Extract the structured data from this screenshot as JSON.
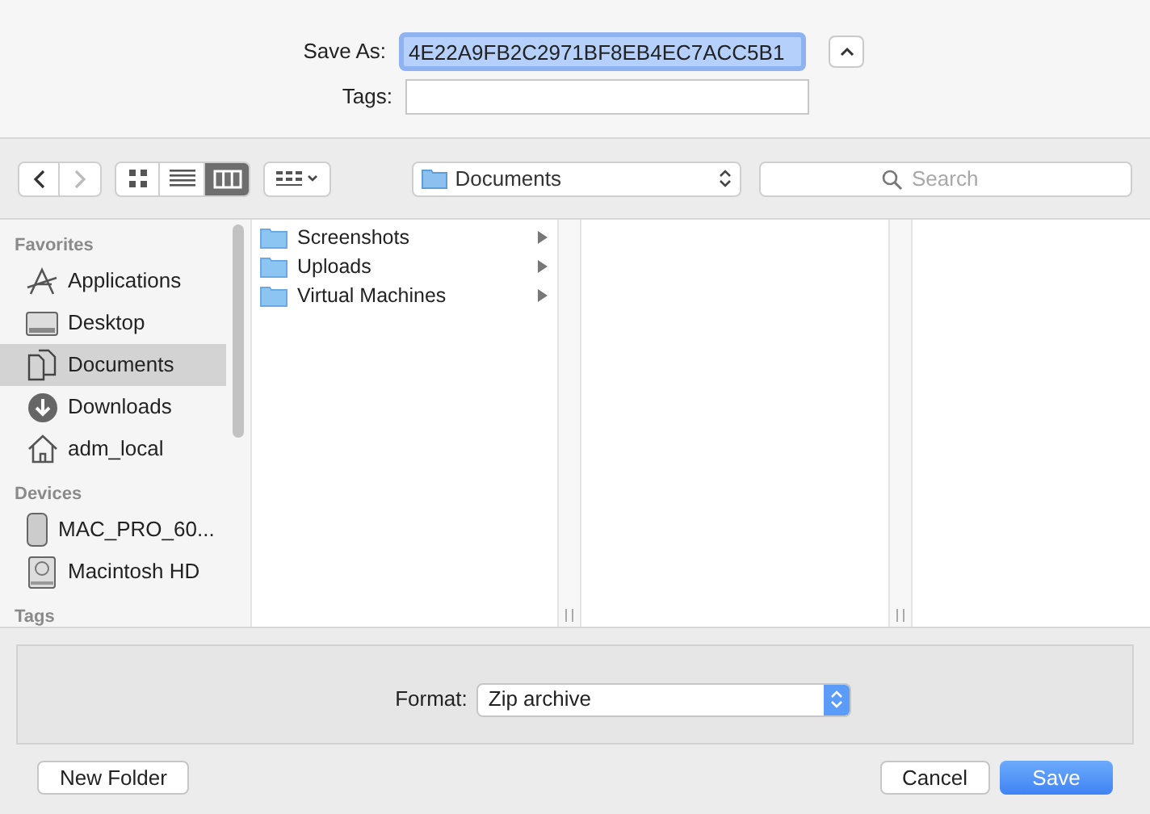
{
  "save_as": {
    "label": "Save As:",
    "value": "4E22A9FB2C2971BF8EB4EC7ACC5B1"
  },
  "tags": {
    "label": "Tags:"
  },
  "toolbar": {
    "view_modes": [
      {
        "selected": false
      },
      {
        "selected": false
      },
      {
        "selected": true
      }
    ],
    "location": "Documents",
    "search": {
      "placeholder": "Search"
    }
  },
  "sidebar": {
    "sections": [
      {
        "title": "Favorites",
        "items": [
          {
            "label": "Applications",
            "selected": false
          },
          {
            "label": "Desktop",
            "selected": false
          },
          {
            "label": "Documents",
            "selected": true
          },
          {
            "label": "Downloads",
            "selected": false
          },
          {
            "label": "adm_local",
            "selected": false
          }
        ]
      },
      {
        "title": "Devices",
        "items": [
          {
            "label": "MAC_PRO_60...",
            "selected": false
          },
          {
            "label": "Macintosh HD",
            "selected": false
          }
        ]
      },
      {
        "title": "Tags"
      }
    ]
  },
  "columns": [
    {
      "items": [
        {
          "label": "Screenshots"
        },
        {
          "label": "Uploads"
        },
        {
          "label": "Virtual Machines"
        }
      ]
    }
  ],
  "format": {
    "label": "Format:",
    "value": "Zip archive"
  },
  "buttons": {
    "new_folder": "New Folder",
    "cancel": "Cancel",
    "save": "Save"
  }
}
